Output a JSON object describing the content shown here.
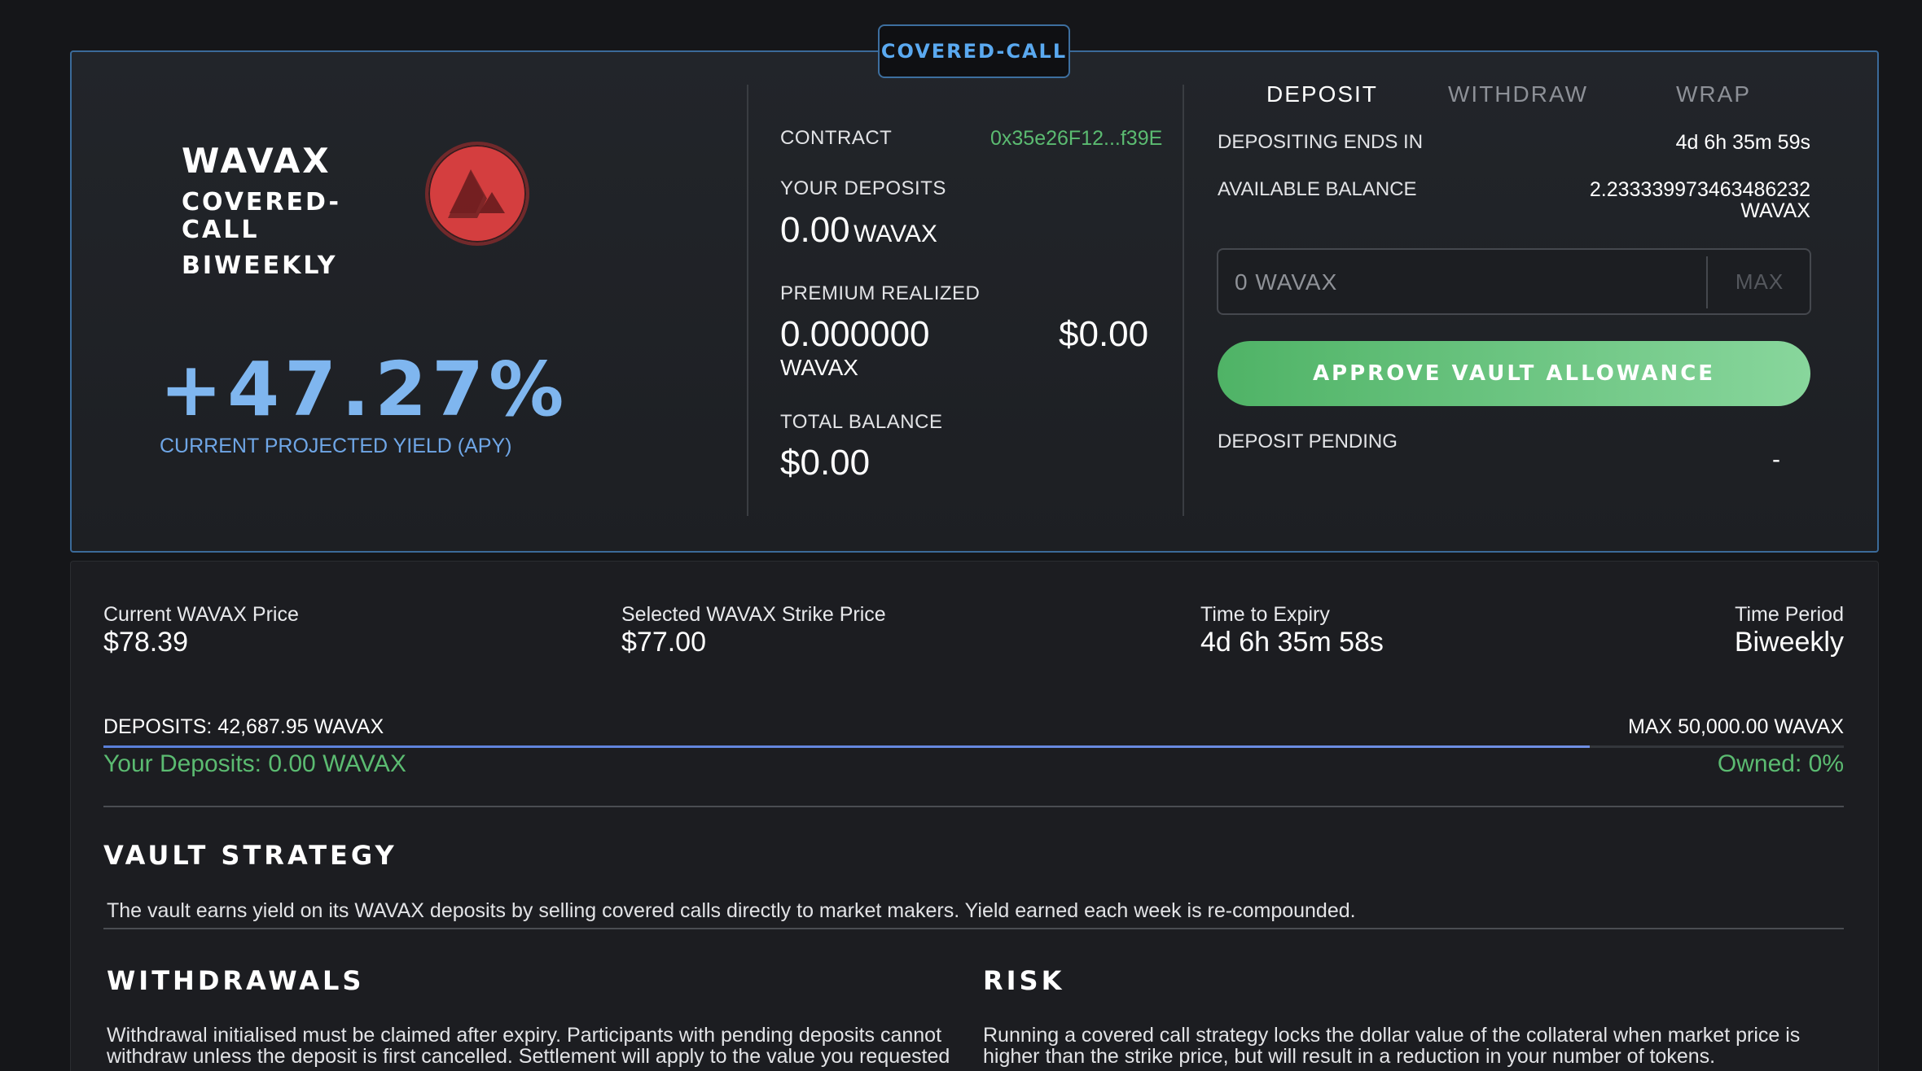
{
  "vault": {
    "type_badge": "COVERED-CALL",
    "asset": "WAVAX",
    "strategy": "COVERED-",
    "strategy2": "CALL",
    "period": "BIWEEKLY",
    "apy": "+47.27%",
    "apy_label": "CURRENT PROJECTED YIELD (APY)",
    "logo_icon": "avalanche-logo-icon"
  },
  "info": {
    "contract_label": "CONTRACT",
    "contract_value": "0x35e26F12...f39E",
    "your_deposits_label": "YOUR DEPOSITS",
    "your_deposits_value": "0.00",
    "your_deposits_unit": "WAVAX",
    "premium_label": "PREMIUM REALIZED",
    "premium_value": "0.000000",
    "premium_unit": "WAVAX",
    "premium_usd": "$0.00",
    "total_balance_label": "TOTAL BALANCE",
    "total_balance_value": "$0.00"
  },
  "tabs": [
    "DEPOSIT",
    "WITHDRAW",
    "WRAP"
  ],
  "deposit": {
    "ends_label": "DEPOSITING ENDS IN",
    "ends_value": "4d 6h 35m 59s",
    "balance_label": "AVAILABLE BALANCE",
    "balance_value": "2.233339973463486232",
    "balance_unit": "WAVAX",
    "input_placeholder": "0 WAVAX",
    "max_label": "MAX",
    "approve_label": "APPROVE VAULT ALLOWANCE",
    "pending_label": "DEPOSIT PENDING",
    "pending_value": "-"
  },
  "stats": {
    "price_label": "Current WAVAX Price",
    "price_value": "$78.39",
    "strike_label": "Selected WAVAX Strike Price",
    "strike_value": "$77.00",
    "expiry_label": "Time to Expiry",
    "expiry_value": "4d 6h 35m 58s",
    "period_label": "Time Period",
    "period_value": "Biweekly"
  },
  "capacity": {
    "deposits_text": "DEPOSITS: 42,687.95 WAVAX",
    "max_text": "MAX 50,000.00 WAVAX",
    "fill_fraction": 0.8538,
    "your_deposits_text": "Your Deposits: 0.00 WAVAX",
    "owned_text": "Owned: 0%"
  },
  "sections": {
    "strategy_title": "VAULT STRATEGY",
    "strategy_text": "The vault earns yield on its WAVAX deposits by selling covered calls directly to market makers. Yield earned each week is re-compounded.",
    "withdrawals_title": "WITHDRAWALS",
    "withdrawals_text1": "Withdrawal initialised must be claimed after expiry. Participants with pending deposits cannot",
    "withdrawals_text2": "withdraw unless the deposit is first cancelled. Settlement will apply to the value you requested",
    "risk_title": "RISK",
    "risk_text1": "Running a covered call strategy locks the dollar value of the collateral when market price is",
    "risk_text2": "higher than the strike price, but will result in a reduction in your number of tokens."
  },
  "colors": {
    "accent_blue": "#7fb6ef",
    "green": "#5bbb71",
    "avax_red": "#e84142"
  }
}
